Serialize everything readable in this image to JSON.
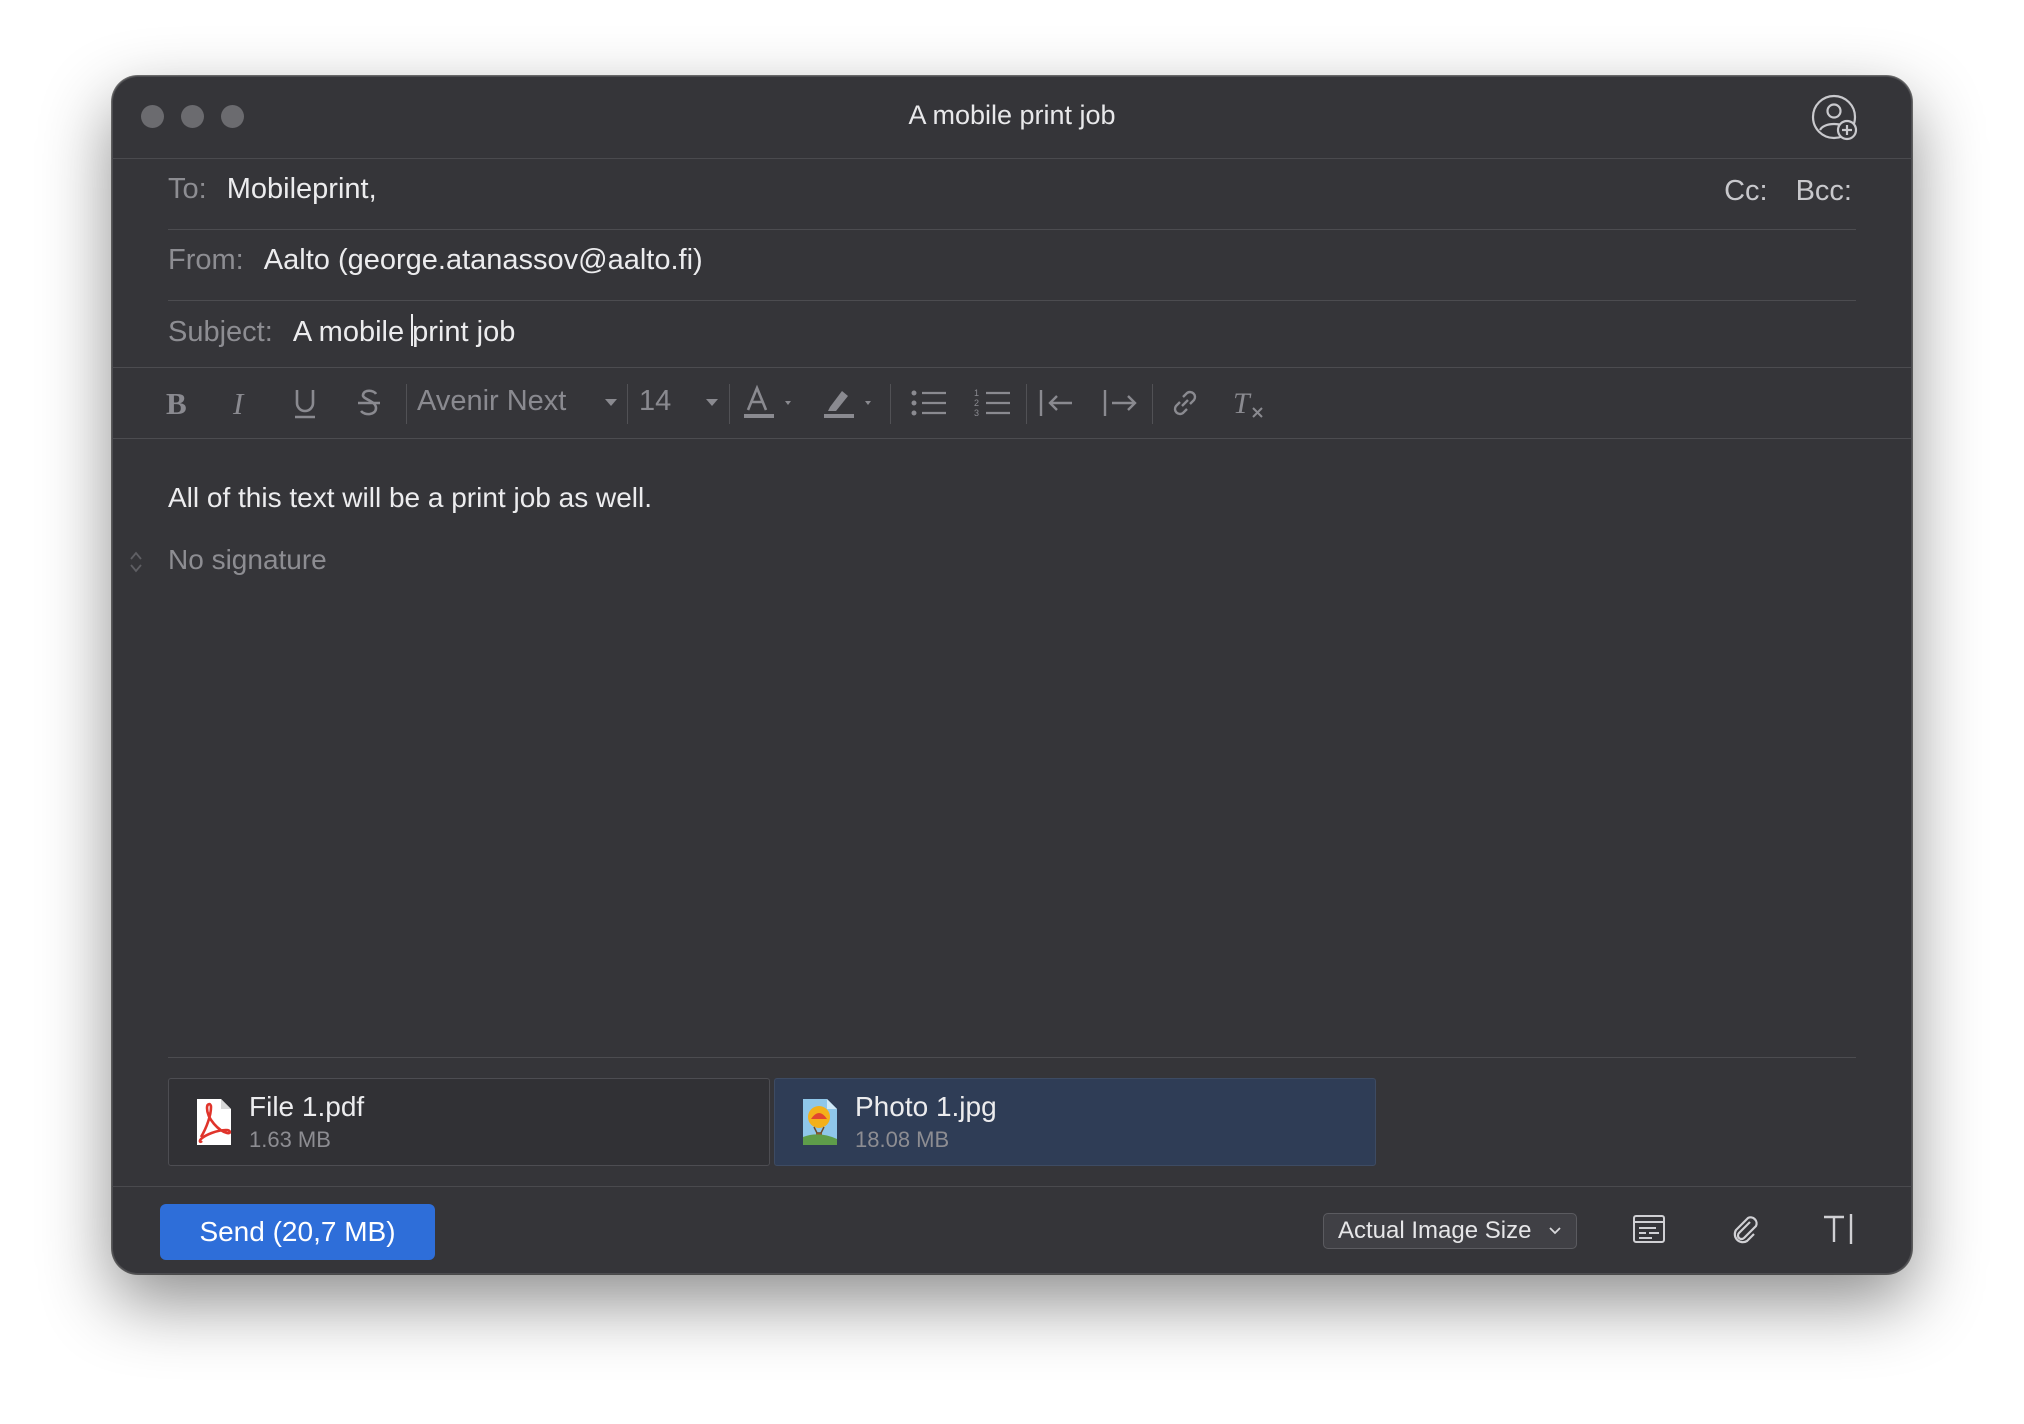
{
  "window": {
    "title": "A mobile print job"
  },
  "header": {
    "to_label": "To:",
    "to_value": "Mobileprint,",
    "cc_label": "Cc:",
    "bcc_label": "Bcc:",
    "from_label": "From:",
    "from_value": "Aalto (george.atanassov@aalto.fi)",
    "subject_label": "Subject:",
    "subject_before_caret": "A mobile ",
    "subject_after_caret": "print job"
  },
  "format_toolbar": {
    "font_name": "Avenir Next",
    "font_size": "14",
    "buttons": [
      "bold-icon",
      "italic-icon",
      "underline-icon",
      "strikethrough-icon",
      "text-color-icon",
      "highlight-color-icon",
      "bulleted-list-icon",
      "numbered-list-icon",
      "decrease-indent-icon",
      "increase-indent-icon",
      "link-icon",
      "clear-formatting-icon"
    ]
  },
  "body": {
    "text": "All of this text will be a print job as well.",
    "signature": "No signature"
  },
  "attachments": [
    {
      "name": "File 1.pdf",
      "size": "1.63 MB",
      "icon": "pdf-file-icon",
      "selected": false
    },
    {
      "name": "Photo 1.jpg",
      "size": "18.08 MB",
      "icon": "image-file-icon",
      "selected": true
    }
  ],
  "footer": {
    "send_label": "Send (20,7 MB)",
    "image_size_option": "Actual Image Size",
    "icons": [
      "templates-icon",
      "attach-file-icon",
      "text-format-icon"
    ]
  },
  "colors": {
    "window_bg": "#353539",
    "accent": "#2e6ed9",
    "selected_attachment": "#2f3d56"
  }
}
